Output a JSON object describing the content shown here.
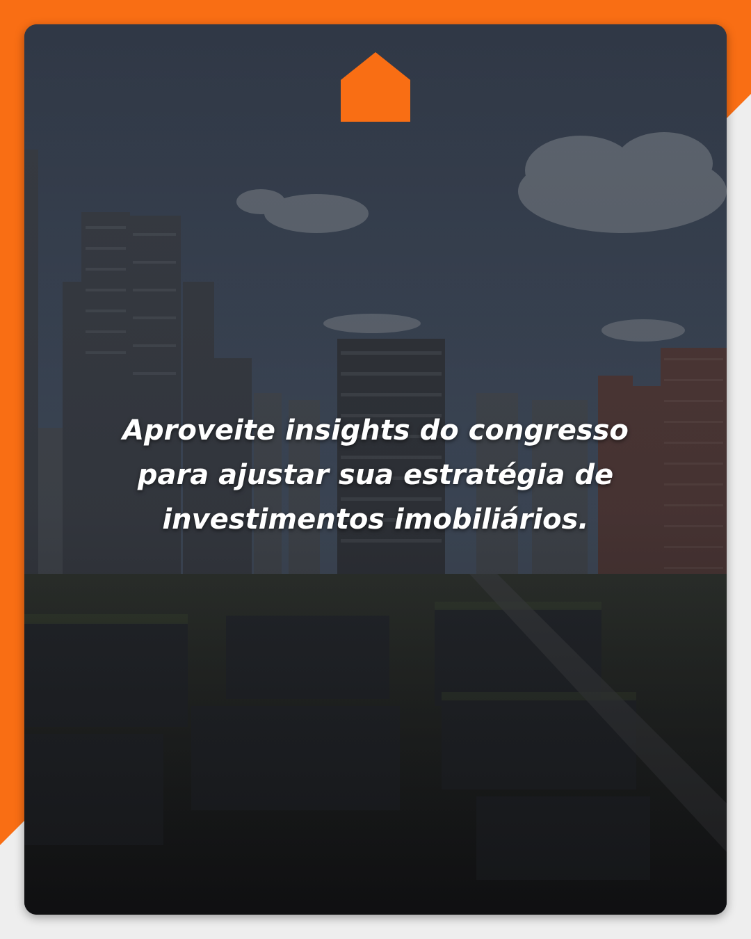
{
  "brand": {
    "accent_color": "#F96E14",
    "logo_icon": "house-icon"
  },
  "headline": {
    "text": "Aproveite insights do congresso para ajustar sua estratégia de investimentos imobiliários."
  },
  "background": {
    "image": "city-skyline-photo"
  }
}
